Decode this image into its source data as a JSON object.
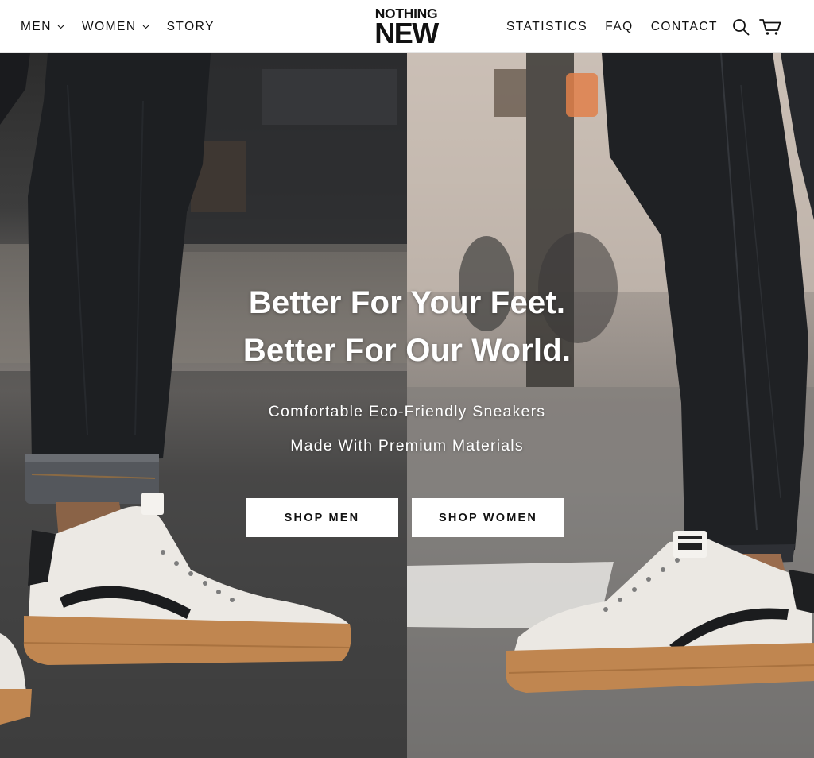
{
  "header": {
    "nav_left": [
      {
        "label": "MEN",
        "has_dropdown": true
      },
      {
        "label": "WOMEN",
        "has_dropdown": true
      },
      {
        "label": "STORY",
        "has_dropdown": false
      }
    ],
    "logo": {
      "line1": "NOTHING",
      "line2": "NEW"
    },
    "nav_right": [
      {
        "label": "STATISTICS"
      },
      {
        "label": "FAQ"
      },
      {
        "label": "CONTACT"
      }
    ],
    "icons": {
      "search": "search-icon",
      "cart": "cart-icon",
      "dropdown": "chevron-down-icon"
    }
  },
  "hero": {
    "headline_line1": "Better For Your Feet.",
    "headline_line2": "Better For Our World.",
    "subheadline_line1": "Comfortable Eco-Friendly Sneakers",
    "subheadline_line2": "Made With Premium Materials",
    "buttons": {
      "shop_men": "SHOP MEN",
      "shop_women": "SHOP WOMEN"
    },
    "images": {
      "left": "man-wearing-white-sneakers-photo",
      "right": "woman-wearing-white-sneakers-photo"
    }
  },
  "colors": {
    "header_bg": "#ffffff",
    "text_dark": "#111111",
    "hero_text": "#ffffff",
    "button_bg": "#ffffff",
    "sole": "#c48a52",
    "denim": "#1f2124"
  }
}
